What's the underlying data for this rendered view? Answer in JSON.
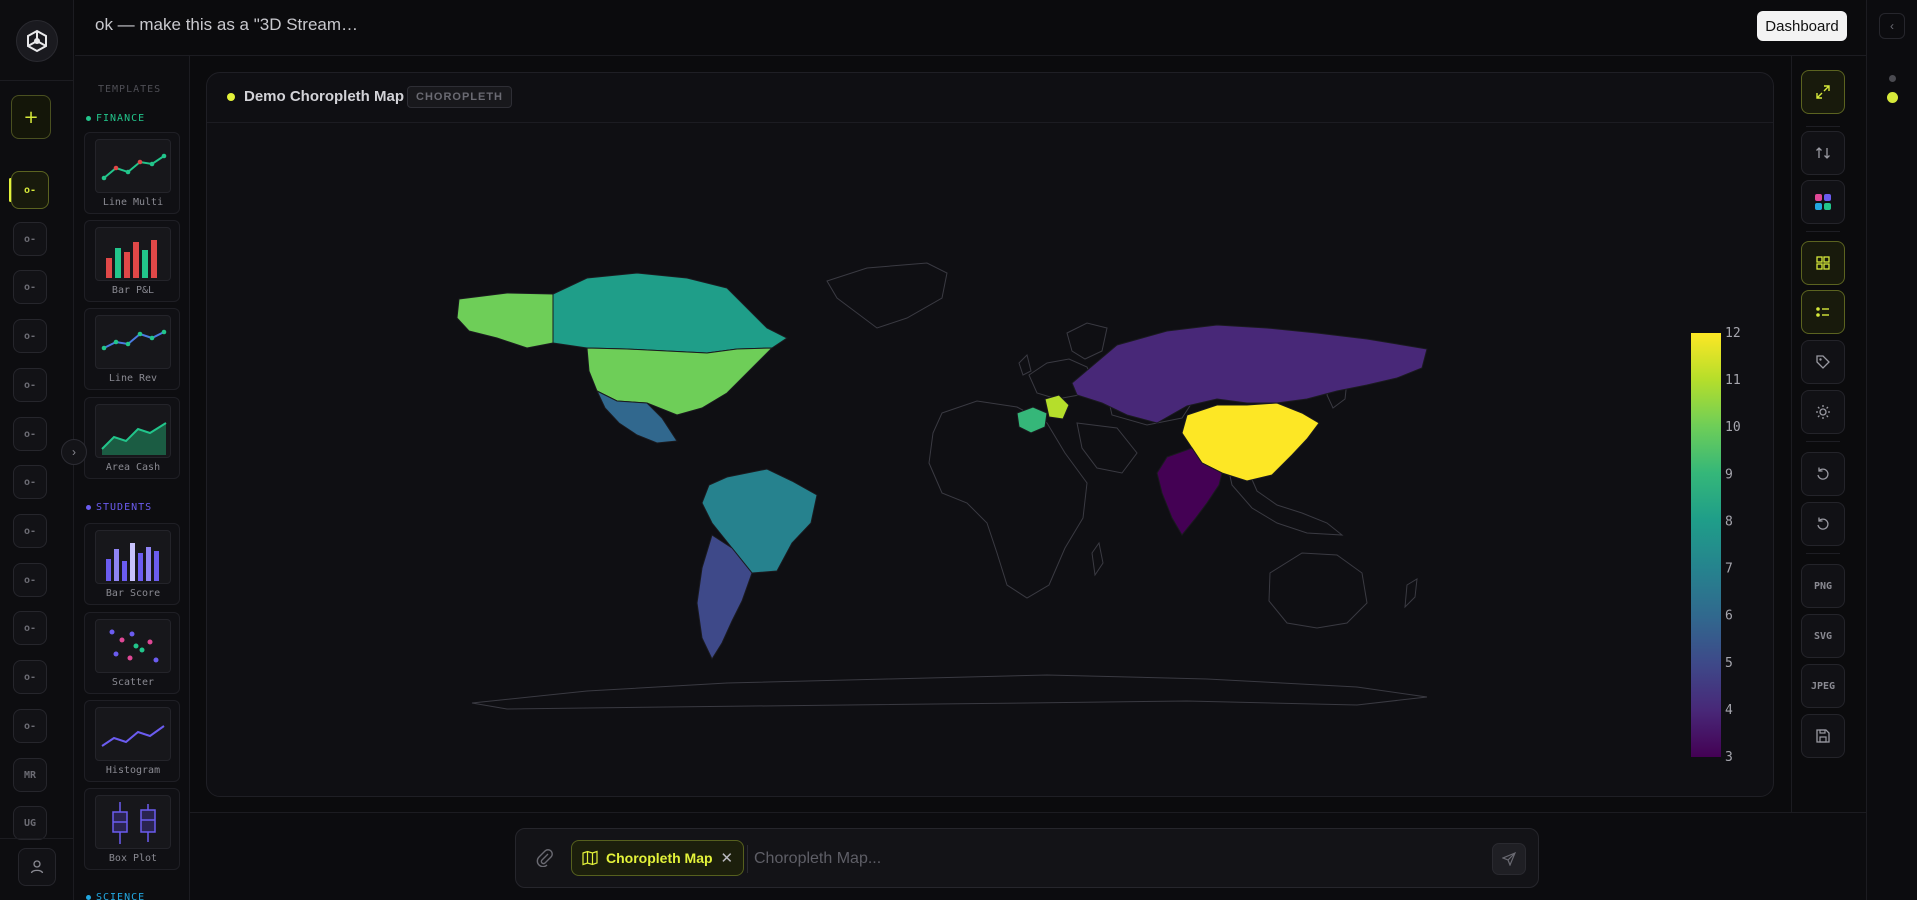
{
  "app": {
    "title": "ok — make this as a \"3D Stream…",
    "dashboard_label": "Dashboard",
    "logo_icon": "cube-logo-icon"
  },
  "rail": {
    "add_label": "+",
    "items": [
      "MR",
      "UG"
    ]
  },
  "templates": {
    "heading": "TEMPLATES",
    "groups": [
      {
        "name": "FINANCE",
        "color": "#22c58b",
        "items": [
          "Line Multi",
          "Bar P&L",
          "Line Rev",
          "Area Cash"
        ]
      },
      {
        "name": "STUDENTS",
        "color": "#6b5cf0",
        "items": [
          "Bar Score",
          "Scatter",
          "Histogram",
          "Box Plot"
        ]
      },
      {
        "name": "SCIENCE",
        "color": "#22a7e0",
        "items": []
      }
    ]
  },
  "panel": {
    "title": "Demo Choropleth Map",
    "badge": "CHOROPLETH"
  },
  "toolbar": {
    "png_label": "PNG",
    "svg_label": "SVG",
    "jpeg_label": "JPEG"
  },
  "prompt": {
    "chip_label": "Choropleth Map",
    "placeholder": "Choropleth Map..."
  },
  "colors": {
    "accent": "#e3f23a",
    "background": "#0b0b0d"
  },
  "chart_data": {
    "type": "choropleth",
    "colorscale": "viridis",
    "range": [
      3,
      12
    ],
    "colorbar_ticks": [
      12,
      11,
      10,
      9,
      8,
      7,
      6,
      5,
      4,
      3
    ],
    "regions": [
      {
        "name": "USA",
        "value": 10
      },
      {
        "name": "Alaska",
        "value": 10
      },
      {
        "name": "Canada",
        "value": 8
      },
      {
        "name": "Mexico",
        "value": 6
      },
      {
        "name": "Brazil",
        "value": 7
      },
      {
        "name": "Argentina",
        "value": 5
      },
      {
        "name": "France",
        "value": 9
      },
      {
        "name": "Germany",
        "value": 11
      },
      {
        "name": "Russia",
        "value": 4
      },
      {
        "name": "China",
        "value": 12
      },
      {
        "name": "India",
        "value": 3
      }
    ]
  }
}
